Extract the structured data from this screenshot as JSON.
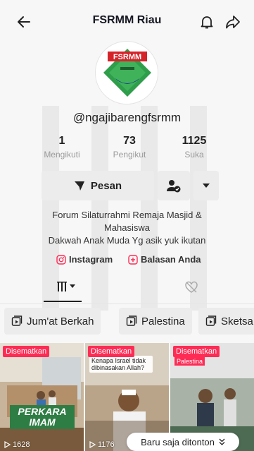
{
  "header": {
    "title": "FSRMM Riau",
    "icons": [
      "back-arrow-icon",
      "bell-icon",
      "share-icon"
    ]
  },
  "profile": {
    "logo_text": "FSRMM",
    "handle": "@ngajibarengfsrmm",
    "stats": [
      {
        "value": "1",
        "label": "Mengikuti"
      },
      {
        "value": "73",
        "label": "Pengikut"
      },
      {
        "value": "1125",
        "label": "Suka"
      }
    ],
    "message_button": "Pesan",
    "bio_line1": "Forum Silaturrahmi Remaja Masjid &",
    "bio_line2": "Mahasiswa",
    "bio_line3": "Dakwah Anak Muda Yg asik yuk ikutan",
    "links": {
      "instagram": "Instagram",
      "reply": "Balasan Anda"
    }
  },
  "playlists": [
    "Jum'at Berkah",
    "Palestina",
    "Sketsa"
  ],
  "videos": [
    {
      "badge": "Disematkan",
      "overlay": "PERKARA IMAM",
      "views": "1628"
    },
    {
      "badge": "Disematkan",
      "overlay": "Kenapa Israel tidak dibinasakan Allah?",
      "views": "1176"
    },
    {
      "badge": "Disematkan",
      "overlay": "Palestina",
      "views": ""
    }
  ],
  "recent_pill": "Baru saja ditonton",
  "colors": {
    "accent": "#fe2c55",
    "logo_green": "#2f9e4b",
    "logo_red": "#d6232a"
  }
}
